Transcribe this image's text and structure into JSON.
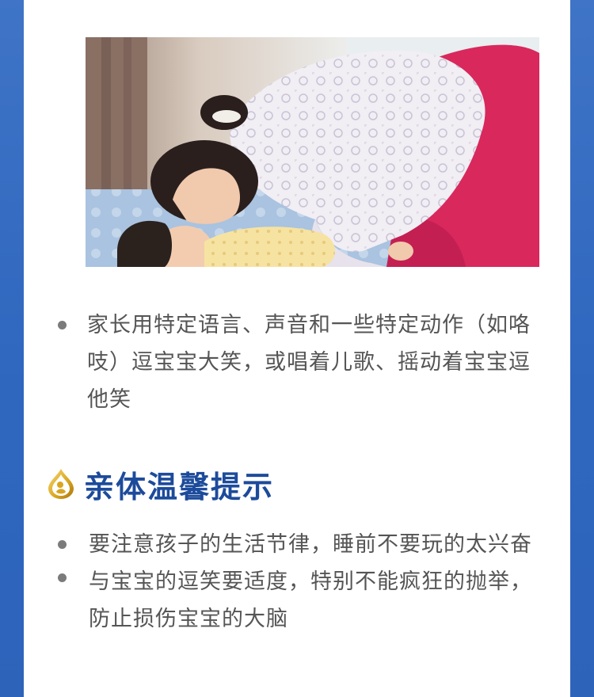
{
  "photo": {
    "icon": "mother-baby-photo"
  },
  "intro_bullets": [
    {
      "text": "家长用特定语言、声音和一些特定动作（如咯吱）逗宝宝大笑，或唱着儿歌、摇动着宝宝逗他笑"
    }
  ],
  "tips": {
    "icon": "gold-drop-icon",
    "title": "亲体温馨提示",
    "items": [
      {
        "text": "要注意孩子的生活节律，睡前不要玩的太兴奋"
      },
      {
        "text": "与宝宝的逗笑要适度，特别不能疯狂的抛举，防止损伤宝宝的大脑"
      }
    ]
  },
  "colors": {
    "frame": "#2f67bf",
    "title": "#1d4b9b",
    "text": "#555555",
    "icon_gold": "#d9a520"
  }
}
